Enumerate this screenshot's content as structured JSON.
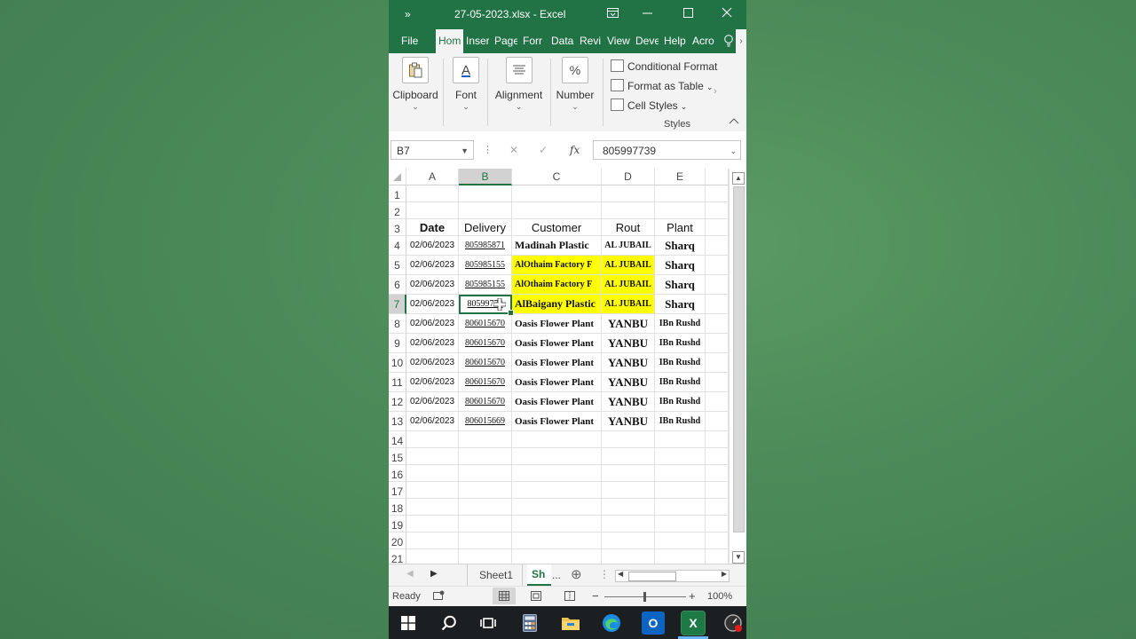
{
  "window": {
    "title": "27-05-2023.xlsx  -  Excel",
    "accent": "#217346"
  },
  "ribbon_tabs": [
    "File",
    "Hom",
    "Inser",
    "Page",
    "Forr",
    "Data",
    "Revi",
    "View",
    "Deve",
    "Help",
    "Acro"
  ],
  "ribbon": {
    "clipboard": "Clipboard",
    "font": "Font",
    "alignment": "Alignment",
    "number": "Number",
    "number_symbol": "%",
    "font_symbol": "A",
    "conditional": "Conditional Format",
    "format_table": "Format as Table",
    "cell_styles": "Cell Styles",
    "styles_group": "Styles"
  },
  "formula_bar": {
    "name_box": "B7",
    "cancel": "✕",
    "enter": "✓",
    "fx": "fx",
    "value": "805997739"
  },
  "columns": [
    "A",
    "B",
    "C",
    "D",
    "E"
  ],
  "selected_column": "B",
  "selected_row": 7,
  "rows": [
    {
      "n": "1",
      "cells": [
        "",
        "",
        "",
        "",
        ""
      ]
    },
    {
      "n": "2",
      "cells": [
        "",
        "",
        "",
        "",
        ""
      ]
    },
    {
      "n": "3",
      "cells": [
        "Date",
        "Delivery",
        "Customer",
        "Rout",
        "Plant"
      ]
    },
    {
      "n": "4",
      "cells": [
        "02/06/2023",
        "805985871",
        "Madinah Plastic",
        "AL JUBAIL",
        "Sharq"
      ]
    },
    {
      "n": "5",
      "cells": [
        "02/06/2023",
        "805985155",
        "AlOthaim Factory F",
        "AL JUBAIL",
        "Sharq"
      ]
    },
    {
      "n": "6",
      "cells": [
        "02/06/2023",
        "805985155",
        "AlOthaim Factory F",
        "AL JUBAIL",
        "Sharq"
      ]
    },
    {
      "n": "7",
      "cells": [
        "02/06/2023",
        "80599773",
        "AlBaigany Plastic",
        "AL JUBAIL",
        "Sharq"
      ]
    },
    {
      "n": "8",
      "cells": [
        "02/06/2023",
        "806015670",
        "Oasis Flower Plant",
        "YANBU",
        "IBn Rushd"
      ]
    },
    {
      "n": "9",
      "cells": [
        "02/06/2023",
        "806015670",
        "Oasis Flower Plant",
        "YANBU",
        "IBn Rushd"
      ]
    },
    {
      "n": "10",
      "cells": [
        "02/06/2023",
        "806015670",
        "Oasis Flower Plant",
        "YANBU",
        "IBn Rushd"
      ]
    },
    {
      "n": "11",
      "cells": [
        "02/06/2023",
        "806015670",
        "Oasis Flower Plant",
        "YANBU",
        "IBn Rushd"
      ]
    },
    {
      "n": "12",
      "cells": [
        "02/06/2023",
        "806015670",
        "Oasis Flower Plant",
        "YANBU",
        "IBn Rushd"
      ]
    },
    {
      "n": "13",
      "cells": [
        "02/06/2023",
        "806015669",
        "Oasis Flower Plant",
        "YANBU",
        "IBn Rushd"
      ]
    },
    {
      "n": "14",
      "cells": [
        "",
        "",
        "",
        "",
        ""
      ]
    },
    {
      "n": "15",
      "cells": [
        "",
        "",
        "",
        "",
        ""
      ]
    },
    {
      "n": "16",
      "cells": [
        "",
        "",
        "",
        "",
        ""
      ]
    },
    {
      "n": "17",
      "cells": [
        "",
        "",
        "",
        "",
        ""
      ]
    },
    {
      "n": "18",
      "cells": [
        "",
        "",
        "",
        "",
        ""
      ]
    },
    {
      "n": "19",
      "cells": [
        "",
        "",
        "",
        "",
        ""
      ]
    },
    {
      "n": "20",
      "cells": [
        "",
        "",
        "",
        "",
        ""
      ]
    },
    {
      "n": "21",
      "cells": [
        "",
        "",
        "",
        "",
        ""
      ]
    }
  ],
  "highlight_color": "#ffff00",
  "highlighted_cells": [
    "C5",
    "D5",
    "C6",
    "D6",
    "C7",
    "D7"
  ],
  "sheet_tabs": {
    "tab1": "Sheet1",
    "tab2": "Sh",
    "more": "...",
    "add": "⊕"
  },
  "status": {
    "ready": "Ready",
    "zoom": "100%",
    "minus": "−",
    "plus": "+"
  },
  "taskbar": [
    "windows-icon",
    "search-icon",
    "task-view-icon",
    "calculator-icon",
    "file-explorer-icon",
    "edge-icon",
    "outlook-icon",
    "excel-icon",
    "recorder-icon"
  ],
  "taskbar_labels": {
    "outlook": "O",
    "excel": "X"
  }
}
